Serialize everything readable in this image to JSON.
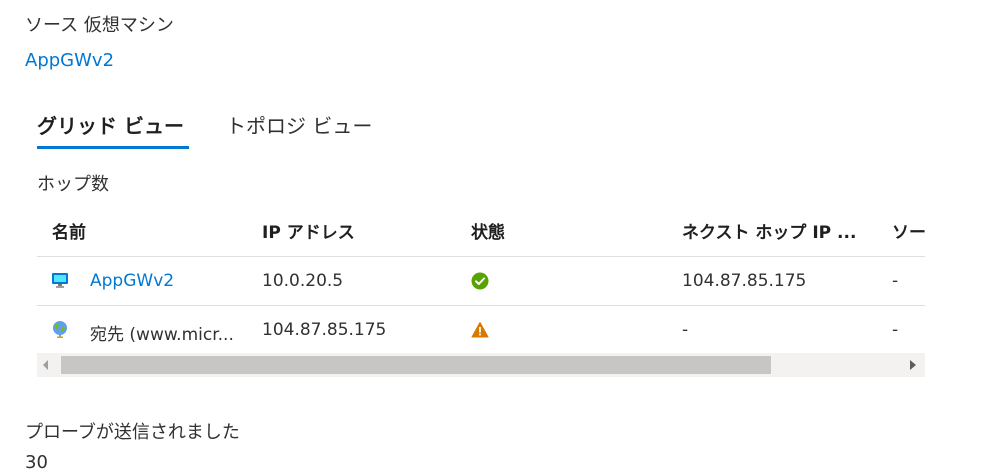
{
  "source": {
    "label": "ソース 仮想マシン",
    "vm_link": "AppGWv2"
  },
  "tabs": [
    {
      "label": "グリッド ビュー",
      "selected": true
    },
    {
      "label": "トポロジ ビュー",
      "selected": false
    }
  ],
  "hops": {
    "label": "ホップ数",
    "columns": [
      "名前",
      "IP アドレス",
      "状態",
      "ネクスト ホップ IP ...",
      "ソー"
    ],
    "rows": [
      {
        "icon": "virtual-machine-icon",
        "name": "AppGWv2",
        "ip": "10.0.20.5",
        "status": "success-check-icon",
        "next_hop_ip": "104.87.85.175",
        "source": "-"
      },
      {
        "icon": "globe-destination-icon",
        "name": "宛先 (www.micr...",
        "ip": "104.87.85.175",
        "status": "warning-icon",
        "next_hop_ip": "-",
        "source": "-"
      }
    ]
  },
  "probes": {
    "label": "プローブが送信されました",
    "value": "30"
  },
  "colors": {
    "accent": "#0078d4",
    "success": "#57a300",
    "warning": "#d97a00"
  }
}
